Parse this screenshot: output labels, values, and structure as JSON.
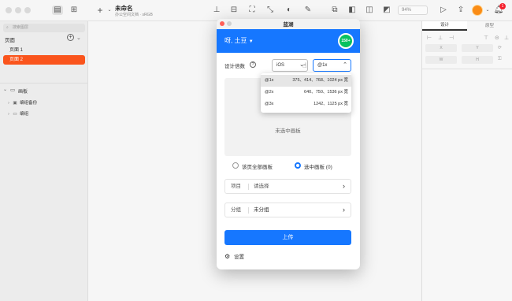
{
  "toolbar": {
    "title": "未命名",
    "subtitle": "办公空间文档 · sRGB",
    "zoom": "94%",
    "notification_count": "1"
  },
  "left_panel": {
    "search_placeholder": "搜索图层",
    "pages_title": "页面",
    "pages": [
      {
        "label": "页面 1",
        "active": false
      },
      {
        "label": "页面 2",
        "active": true
      }
    ],
    "boards_title": "画板",
    "layers": [
      {
        "label": "编组备份"
      },
      {
        "label": "编组"
      }
    ]
  },
  "right_panel": {
    "tabs": [
      "设计",
      "原型"
    ],
    "fields": [
      "X",
      "Y",
      "W",
      "H"
    ]
  },
  "dialog": {
    "window_title": "蓝湖",
    "greeting": "呀, 土豆",
    "badge": "150+",
    "scale_label": "设计倍数",
    "platform_value": "iOS",
    "scale_value": "@1x",
    "dropdown_options": [
      {
        "scale": "@1x",
        "sizes": "375、414、768、1024 px 宽"
      },
      {
        "scale": "@2x",
        "sizes": "640、750、1536 px 宽"
      },
      {
        "scale": "@3x",
        "sizes": "1242、1125 px 宽"
      }
    ],
    "preview_empty_text": "未选中画板",
    "radio_all_label": "该页全部画板",
    "radio_selected_label": "选中画板 (0)",
    "project_label": "项目",
    "project_value": "请选择",
    "group_label": "分组",
    "group_value": "未分组",
    "upload_button": "上传",
    "settings_label": "设置"
  },
  "colors": {
    "accent": "#1677ff",
    "active_page": "#fa541c",
    "notification": "#f5222d"
  }
}
